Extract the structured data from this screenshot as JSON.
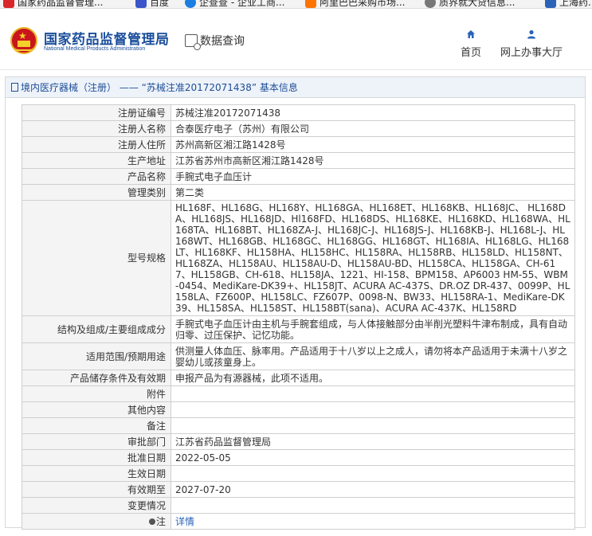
{
  "bookmarks": [
    {
      "label": "国家药品监督管理...",
      "icon": "red-emblem-icon"
    },
    {
      "label": "百度",
      "icon": "baidu-icon"
    },
    {
      "label": "企查查 - 企业工商...",
      "icon": "qichacha-icon"
    },
    {
      "label": "阿里巴巴采购市场...",
      "icon": "alibaba-icon"
    },
    {
      "label": "质界就大贷信息...",
      "icon": "globe-icon"
    },
    {
      "label": "上海药...",
      "icon": "shanghai-icon"
    }
  ],
  "header": {
    "logo_cn": "国家药品监督管理局",
    "logo_en": "National Medical Products Administration",
    "data_query": "数据查询",
    "nav": [
      {
        "label": "首页",
        "icon": "home-icon"
      },
      {
        "label": "网上办事大厅",
        "icon": "user-icon"
      }
    ]
  },
  "panel": {
    "title": "境内医疗器械（注册） —— “苏械注准20172071438” 基本信息"
  },
  "rows": [
    {
      "label": "注册证编号",
      "value": "苏械注准20172071438"
    },
    {
      "label": "注册人名称",
      "value": "合泰医疗电子（苏州）有限公司"
    },
    {
      "label": "注册人住所",
      "value": "苏州高新区湘江路1428号"
    },
    {
      "label": "生产地址",
      "value": "江苏省苏州市高新区湘江路1428号"
    },
    {
      "label": "产品名称",
      "value": "手腕式电子血压计"
    },
    {
      "label": "管理类别",
      "value": "第二类"
    },
    {
      "label": "型号规格",
      "value": "HL168F、HL168G、HL168Y、HL168GA、HL168ET、HL168KB、HL168JC、 HL168DA、HL168JS、HL168JD、Hl168FD、HL168DS、HL168KE、HL168KD、HL168WA、HL168TA、HL168BT、HL168ZA-J、HL168JC-J、HL168JS-J、HL168KB-J、HL168L-J、HL168WT、HL168GB、HL168GC、HL168GG、HL168GT、HL168IA、HL168LG、HL168LT、HL168KF、HL158HA、HL158HC、HL158RA、HL158RB、HL158LD、HL158NT、HL168ZA、HL158AU、HL158AU-D、HL158AU-BD、HL158CA、HL158GA、CH-617、HL158GB、CH-618、HL158JA、1221、HI-158、BPM158、AP6003 HM-55、WBM-0454、MediKare-DK39+、HL158JT、ACURA AC-437S、DR.OZ DR-437、0099P、HL158LA、FZ600P、HL158LC、FZ607P、0098-N、BW33、HL158RA-1、MediKare-DK39、HL158SA、HL158ST、HL158BT(sana)、ACURA AC-437K、HL158RD"
    },
    {
      "label": "结构及组成/主要组成成分",
      "value": "手腕式电子血压计由主机与手腕套组成，与人体接触部分由半削光塑料牛津布制成，具有自动归零、过压保护、记忆功能。"
    },
    {
      "label": "适用范围/预期用途",
      "value": "供测量人体血压、脉率用。产品适用于十八岁以上之成人，请勿将本产品适用于未满十八岁之婴幼儿或孩童身上。"
    },
    {
      "label": "产品储存条件及有效期",
      "value": "申报产品为有源器械，此项不适用。"
    },
    {
      "label": "附件",
      "value": ""
    },
    {
      "label": "其他内容",
      "value": ""
    },
    {
      "label": "备注",
      "value": ""
    },
    {
      "label": "审批部门",
      "value": "江苏省药品监督管理局"
    },
    {
      "label": "批准日期",
      "value": "2022-05-05"
    },
    {
      "label": "生效日期",
      "value": ""
    },
    {
      "label": "有效期至",
      "value": "2027-07-20"
    },
    {
      "label": "变更情况",
      "value": ""
    },
    {
      "label": "注",
      "value": "详情"
    }
  ],
  "colors": {
    "brand_blue": "#1b4e9b",
    "link_blue": "#2763b8",
    "emblem_red": "#c9151e",
    "emblem_gold": "#f5cf2b"
  }
}
